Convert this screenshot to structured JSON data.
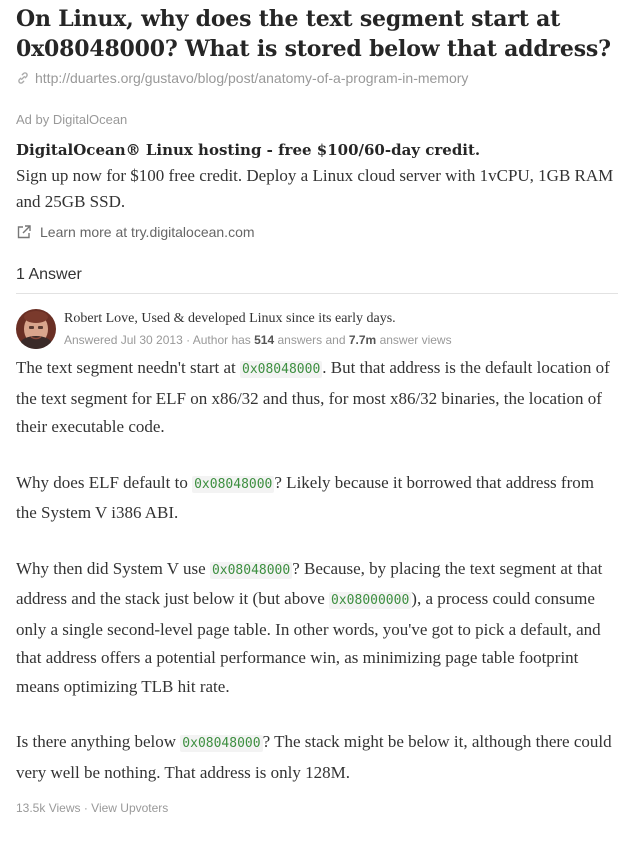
{
  "question": {
    "title": "On Linux, why does the text segment start at 0x08048000? What is stored below that address?",
    "source_url": "http://duartes.org/gustavo/blog/post/anatomy-of-a-program-in-memory"
  },
  "ad": {
    "label": "Ad by DigitalOcean",
    "headline": "DigitalOcean® Linux hosting - free $100/60-day credit.",
    "body": "Sign up now for $100 free credit. Deploy a Linux cloud server with 1vCPU, 1GB RAM and 25GB SSD.",
    "link_text": "Learn more at try.digitalocean.com"
  },
  "answers_header": "1 Answer",
  "answer": {
    "author_name": "Robert Love",
    "author_cred": ", Used & developed Linux since its early days.",
    "answered": "Answered Jul 30 2013",
    "meta_sep": " · Author has ",
    "answers_count": "514",
    "answers_and": " answers and ",
    "views_count": "7.7m",
    "views_label": " answer views",
    "p1_a": "The text segment needn't start at ",
    "p1_code": "0x08048000",
    "p1_b": ". But that address is the default location of the text segment for ELF on x86/32 and thus, for most x86/32 binaries, the location of their executable code.",
    "p2_a": "Why does ELF default to ",
    "p2_code": "0x08048000",
    "p2_b": "? Likely because it borrowed that address from the System V i386 ABI.",
    "p3_a": "Why then did System V use ",
    "p3_code1": "0x08048000",
    "p3_b": "? Because, by placing the text segment at that address and the stack just below it (but above ",
    "p3_code2": "0x08000000",
    "p3_c": "), a process could consume only a single second-level page table. In other words, you've got to pick a default, and that address offers a potential performance win, as minimizing page table footprint means optimizing TLB hit rate.",
    "p4_a": "Is there anything below ",
    "p4_code": "0x08048000",
    "p4_b": "? The stack might be below it, although there could very well be nothing. That address is only 128M."
  },
  "footer": {
    "views": "13.5k Views",
    "sep": " · ",
    "upvoters": "View Upvoters"
  },
  "icons": {
    "source": "link-icon",
    "ad_link": "external-link-icon",
    "avatar": "avatar"
  },
  "colors": {
    "code_text": "#3d8f40",
    "muted": "#999999"
  }
}
